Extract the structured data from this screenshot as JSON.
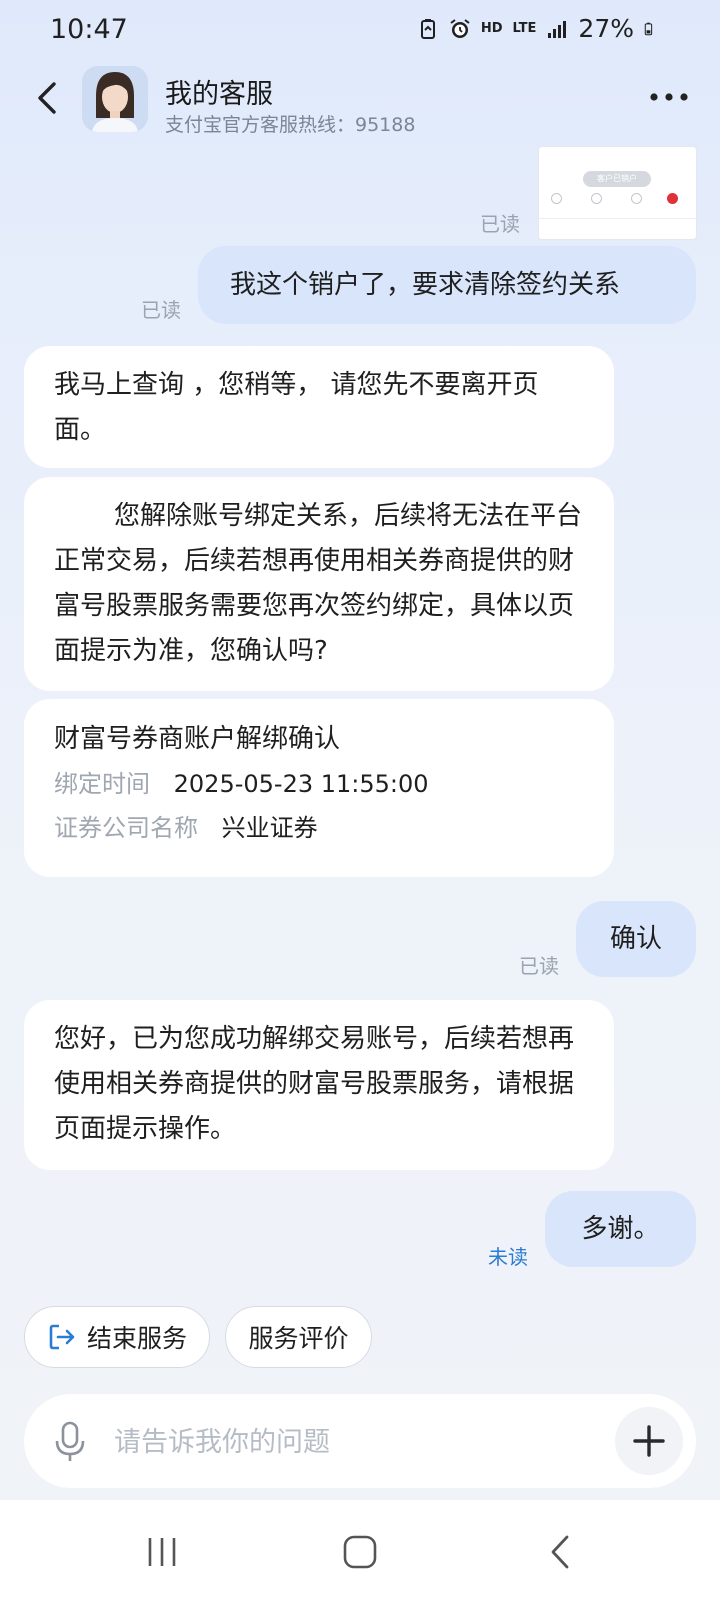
{
  "status_bar": {
    "time": "10:47",
    "network": "HD",
    "lte": "LTE",
    "battery": "27%"
  },
  "header": {
    "title": "我的客服",
    "subtitle": "支付宝官方客服热线：95188"
  },
  "thumbnail": {
    "pill_text": "客户已销户"
  },
  "messages": {
    "m1_status": "已读",
    "m2_text": "我这个销户了，要求清除签约关系",
    "m2_status": "已读",
    "r1_text": "我马上查询 ，您稍等， 请您先不要离开页面。",
    "r2_text": "您解除账号绑定关系，后续将无法在平台正常交易，后续若想再使用相关券商提供的财富号股票服务需要您再次签约绑定，具体以页面提示为准，您确认吗?",
    "card": {
      "title": "财富号券商账户解绑确认",
      "bind_time_label": "绑定时间",
      "bind_time_value": "2025-05-23 11:55:00",
      "company_label": "证券公司名称",
      "company_value": "兴业证券"
    },
    "m3_text": "确认",
    "m3_status": "已读",
    "r3_text": "您好，已为您成功解绑交易账号，后续若想再使用相关券商提供的财富号股票服务，请根据页面提示操作。",
    "m4_text": "多谢。",
    "m4_status": "未读"
  },
  "actions": {
    "end_service": "结束服务",
    "rate_service": "服务评价"
  },
  "input": {
    "placeholder": "请告诉我你的问题"
  },
  "colors": {
    "user_bubble": "#d9e5fa",
    "unread": "#2b7cd3",
    "accent": "#2b7cd3"
  }
}
